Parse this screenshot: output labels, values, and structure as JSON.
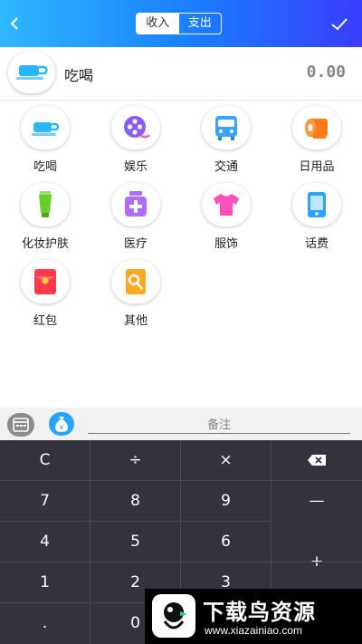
{
  "header": {
    "back_icon": "chevron-left-icon",
    "confirm_icon": "checkmark-icon",
    "tabs": [
      {
        "label": "收入",
        "active": false
      },
      {
        "label": "支出",
        "active": true
      }
    ]
  },
  "selected": {
    "icon": "cup-icon",
    "name": "吃喝",
    "amount": "0.00"
  },
  "categories": [
    {
      "label": "吃喝",
      "icon": "cup-icon",
      "color": "#28b6ff"
    },
    {
      "label": "娱乐",
      "icon": "film-reel-icon",
      "color": "#8a5cf5"
    },
    {
      "label": "交通",
      "icon": "bus-icon",
      "color": "#3aa3ff"
    },
    {
      "label": "日用品",
      "icon": "toilet-paper-icon",
      "color": "#ff7a1a"
    },
    {
      "label": "化妆护肤",
      "icon": "cosmetic-tube-icon",
      "color": "#66d02a"
    },
    {
      "label": "医疗",
      "icon": "medicine-bottle-icon",
      "color": "#b06cff"
    },
    {
      "label": "服饰",
      "icon": "tshirt-icon",
      "color": "#ff4fb8"
    },
    {
      "label": "话费",
      "icon": "phone-icon",
      "color": "#2aa2ff"
    },
    {
      "label": "红包",
      "icon": "red-envelope-icon",
      "color": "#ff3b4b"
    },
    {
      "label": "其他",
      "icon": "search-document-icon",
      "color": "#ffa820"
    }
  ],
  "note": {
    "calendar_icon": "calendar-icon",
    "money_icon": "money-bag-icon",
    "placeholder": "备注"
  },
  "keypad": {
    "row1": [
      "C",
      "÷",
      "×"
    ],
    "backspace_icon": "backspace-icon",
    "row2": [
      "7",
      "8",
      "9",
      "—"
    ],
    "row3": [
      "4",
      "5",
      "6"
    ],
    "plus": "+",
    "row4": [
      "1",
      "2",
      "3"
    ],
    "row5": [
      ".",
      "0"
    ]
  },
  "watermark": {
    "title": "下载鸟资源",
    "url": "www.xiazainiao.com"
  }
}
